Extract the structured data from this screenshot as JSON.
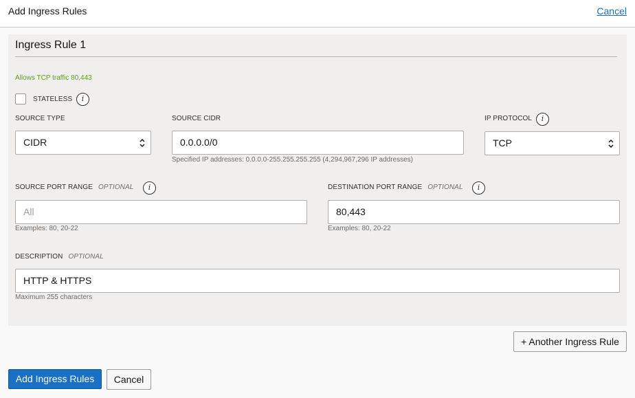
{
  "header": {
    "title": "Add Ingress Rules",
    "cancel_label": "Cancel"
  },
  "rule": {
    "title": "Ingress Rule 1",
    "summary": "Allows TCP traffic 80,443",
    "stateless": {
      "label": "STATELESS",
      "checked": false
    },
    "source_type": {
      "label": "SOURCE TYPE",
      "value": "CIDR"
    },
    "source_cidr": {
      "label": "SOURCE CIDR",
      "value": "0.0.0.0/0",
      "hint": "Specified IP addresses: 0.0.0.0-255.255.255.255 (4,294,967,296 IP addresses)"
    },
    "ip_protocol": {
      "label": "IP PROTOCOL",
      "value": "TCP"
    },
    "source_port_range": {
      "label": "SOURCE PORT RANGE",
      "optional": "OPTIONAL",
      "placeholder": "All",
      "value": "",
      "hint": "Examples: 80, 20-22"
    },
    "destination_port_range": {
      "label": "DESTINATION PORT RANGE",
      "optional": "OPTIONAL",
      "value": "80,443",
      "hint": "Examples: 80, 20-22"
    },
    "description": {
      "label": "DESCRIPTION",
      "optional": "OPTIONAL",
      "value": "HTTP & HTTPS",
      "hint": "Maximum 255 characters"
    }
  },
  "actions": {
    "another_rule_label": "+ Another Ingress Rule",
    "submit_label": "Add Ingress Rules",
    "cancel_label": "Cancel"
  },
  "icons": {
    "info": "i"
  },
  "colors": {
    "accent": "#1a70c4",
    "link": "#1c6fb0",
    "summary": "#5ea01e",
    "panel": "#f1efed"
  }
}
